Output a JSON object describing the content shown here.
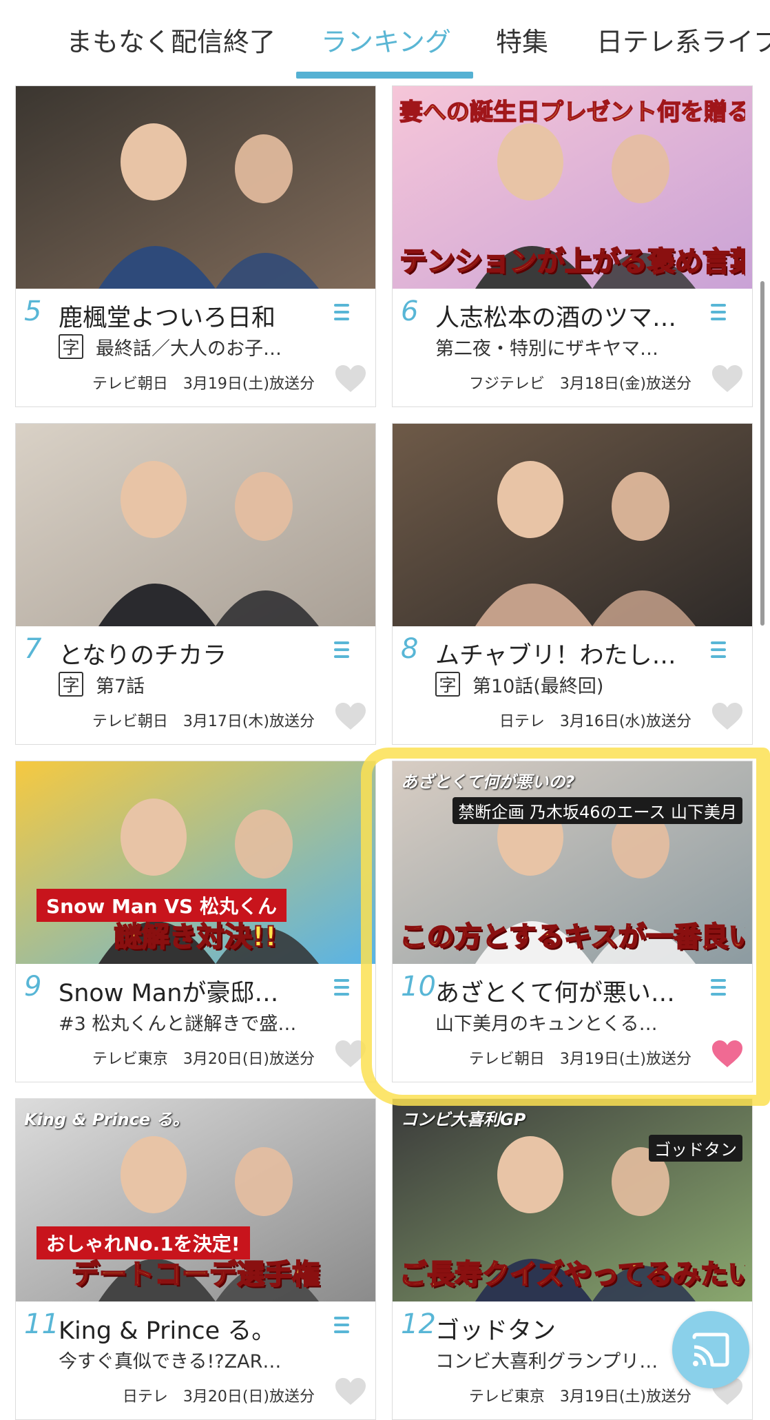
{
  "tabs": [
    {
      "label": "まもなく配信終了",
      "active": false
    },
    {
      "label": "ランキング",
      "active": true
    },
    {
      "label": "特集",
      "active": false
    },
    {
      "label": "日テレ系ライブ",
      "active": false
    }
  ],
  "cards": [
    {
      "rank": "5",
      "title": "鹿楓堂よついろ日和",
      "subtitle_badge": "字",
      "subtitle": "最終話／大人のお子…",
      "meta": "テレビ朝日　3月19日(土)放送分",
      "favorited": false
    },
    {
      "rank": "6",
      "title": "人志松本の酒のツマ…",
      "subtitle_badge": "",
      "subtitle": "第二夜・特別にザキヤマ…",
      "meta": "フジテレビ　3月18日(金)放送分",
      "favorited": false,
      "thumb_headline": "妻への誕生日プレゼント何を贈る?",
      "thumb_caption": "テンションが上がる褒め言葉"
    },
    {
      "rank": "7",
      "title": "となりのチカラ",
      "subtitle_badge": "字",
      "subtitle": "第7話",
      "meta": "テレビ朝日　3月17日(木)放送分",
      "favorited": false
    },
    {
      "rank": "8",
      "title": "ムチャブリ！わたし…",
      "subtitle_badge": "字",
      "subtitle": "第10話(最終回)",
      "meta": "日テレ　3月16日(水)放送分",
      "favorited": false
    },
    {
      "rank": "9",
      "title": "Snow Manが豪邸…",
      "subtitle_badge": "",
      "subtitle": "#3 松丸くんと謎解きで盛…",
      "meta": "テレビ東京　3月20日(日)放送分",
      "favorited": false,
      "thumb_banner": "Snow Man VS 松丸くん",
      "thumb_caption": "謎解き対決!!"
    },
    {
      "rank": "10",
      "title": "あざとくて何が悪い…",
      "subtitle_badge": "",
      "subtitle": "山下美月のキュンとくる…",
      "meta": "テレビ朝日　3月19日(土)放送分",
      "favorited": true,
      "thumb_logo": "あざとくて何が悪いの?",
      "thumb_badge": "禁断企画 乃木坂46のエース 山下美月",
      "thumb_caption": "この方とするキスが一番良いんだ"
    },
    {
      "rank": "11",
      "title": "King & Prince る。",
      "subtitle_badge": "",
      "subtitle": "今すぐ真似できる!?ZAR…",
      "meta": "日テレ　3月20日(日)放送分",
      "favorited": false,
      "thumb_logo": "King & Prince る。",
      "thumb_banner": "おしゃれNo.1を決定!",
      "thumb_caption": "デートコーデ選手権"
    },
    {
      "rank": "12",
      "title": "ゴッドタン",
      "subtitle_badge": "",
      "subtitle": "コンビ大喜利グランプリ…",
      "meta": "テレビ東京　3月19日(土)放送分",
      "favorited": false,
      "thumb_logo": "コンビ大喜利GP",
      "thumb_badge": "ゴッドタン",
      "thumb_caption": "ご長寿クイズやってるみたい"
    }
  ],
  "colors": {
    "accent": "#58b6d6",
    "favorite": "#f06a93",
    "heart_off": "#dcdcdc",
    "highlight": "#fce152"
  },
  "icons": {
    "menu": "list-icon",
    "favorite": "heart-icon",
    "cast": "cast-icon",
    "subtitles": "subtitle-badge"
  }
}
